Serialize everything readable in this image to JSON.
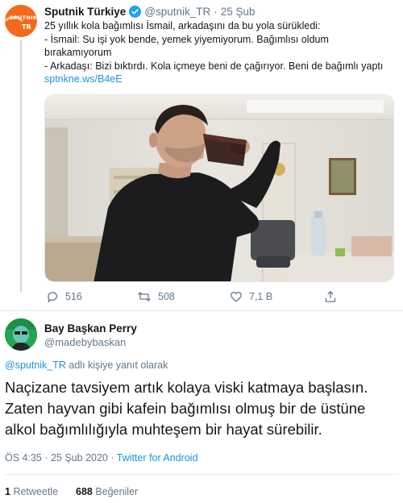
{
  "quoted_tweet": {
    "display_name": "Sputnik Türkiye",
    "handle": "@sputnik_TR",
    "separator": "·",
    "date": "25 Şub",
    "avatar_text": "SPUTNIK",
    "avatar_sub": "TR",
    "text_lines": [
      "25 yıllık kola bağımlısı İsmail, arkadaşını da bu yola sürükledi:",
      "- İsmail: Su işi yok bende, yemek yiyemiyorum. Bağımlısı oldum",
      "bırakamıyorum",
      "- Arkadaşı: Bizi bıktırdı. Kola içmeye beni de çağırıyor. Beni de bağımlı yaptı"
    ],
    "link": "sptnkne.ws/B4eE",
    "actions": {
      "replies": "516",
      "retweets": "508",
      "likes": "7,1 B"
    }
  },
  "main_tweet": {
    "display_name": "Bay Başkan Perry",
    "handle": "@madebybaskan",
    "reply_handle": "@sputnik_TR",
    "reply_suffix": " adlı kişiye yanıt olarak",
    "text_lines": [
      "Naçizane tavsiyem artık kolaya viski katmaya başlasın.",
      "Zaten hayvan gibi kafein bağımlısı olmuş bir de üstüne",
      "alkol bağımlılığıyla muhteşem bir hayat sürebilir."
    ],
    "time": "ÖS 4:35",
    "meta_separator": " · ",
    "date": "25 Şub 2020",
    "source": "Twitter for Android",
    "retweet_count": "1",
    "retweet_label": "Retweetle",
    "like_count": "688",
    "like_label": "Beğeniler"
  },
  "colors": {
    "accent": "#1b95e0",
    "muted": "#657786",
    "text": "#14171a",
    "sputnik_orange": "#f26a1b",
    "verified_blue": "#1da1f2"
  }
}
